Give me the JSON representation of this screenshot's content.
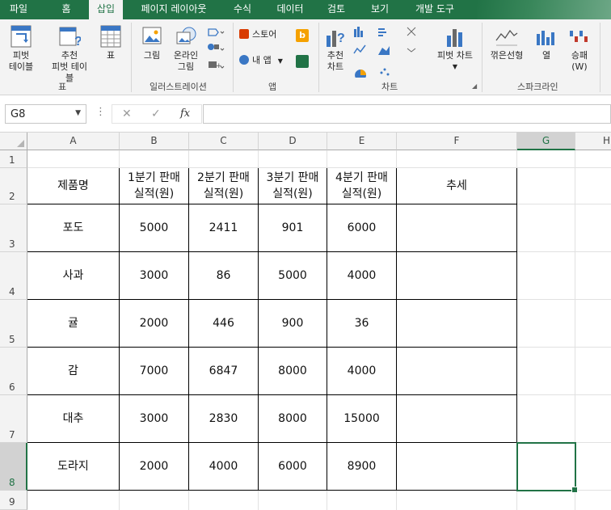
{
  "tabs": [
    {
      "label": "파일",
      "active": false
    },
    {
      "label": "홈",
      "active": false
    },
    {
      "label": "삽입",
      "active": true
    },
    {
      "label": "페이지 레이아웃",
      "active": false
    },
    {
      "label": "수식",
      "active": false
    },
    {
      "label": "데이터",
      "active": false
    },
    {
      "label": "검토",
      "active": false
    },
    {
      "label": "보기",
      "active": false
    },
    {
      "label": "개발 도구",
      "active": false
    }
  ],
  "ribbon": {
    "tables": {
      "pivot_table": "피벗\n테이블",
      "recommended_pivot": "추천\n피벗 테이블",
      "table": "표",
      "group": "표"
    },
    "illustrations": {
      "picture": "그림",
      "online_picture": "온라인\n그림",
      "group": "일러스트레이션"
    },
    "apps": {
      "store": "스토어",
      "my_apps": "내 앱",
      "group": "앱"
    },
    "charts": {
      "recommended": "추천\n차트",
      "pivot_chart": "피벗 차트",
      "group": "차트"
    },
    "sparklines": {
      "line": "꺾은선형",
      "column": "열",
      "winloss": "승패\n(W)",
      "group": "스파크라인"
    },
    "colors": {
      "store_icon": "#d83b01",
      "bing_icon": "#f5a100",
      "chart_blue": "#3a77c4",
      "sparkline_red": "#c0392b",
      "excel_green": "#217346"
    }
  },
  "formula_bar": {
    "name_box": "G8",
    "cancel_icon": "✕",
    "enter_icon": "✓",
    "fx_icon": "fx",
    "formula": ""
  },
  "columns": [
    "A",
    "B",
    "C",
    "D",
    "E",
    "F",
    "G",
    "H"
  ],
  "selected_column": "G",
  "rows": [
    "1",
    "2",
    "3",
    "4",
    "5",
    "6",
    "7",
    "8",
    "9"
  ],
  "selected_row": "8",
  "table": {
    "headers": [
      "제품명",
      "1분기 판매\n실적(원)",
      "2분기 판매\n실적(원)",
      "3분기 판매\n실적(원)",
      "4분기 판매\n실적(원)",
      "추세"
    ],
    "rows": [
      [
        "포도",
        "5000",
        "2411",
        "901",
        "6000",
        ""
      ],
      [
        "사과",
        "3000",
        "86",
        "5000",
        "4000",
        ""
      ],
      [
        "귤",
        "2000",
        "446",
        "900",
        "36",
        ""
      ],
      [
        "감",
        "7000",
        "6847",
        "8000",
        "4000",
        ""
      ],
      [
        "대추",
        "3000",
        "2830",
        "8000",
        "15000",
        ""
      ],
      [
        "도라지",
        "2000",
        "4000",
        "6000",
        "8900",
        ""
      ]
    ]
  },
  "selected_cell": "G8"
}
